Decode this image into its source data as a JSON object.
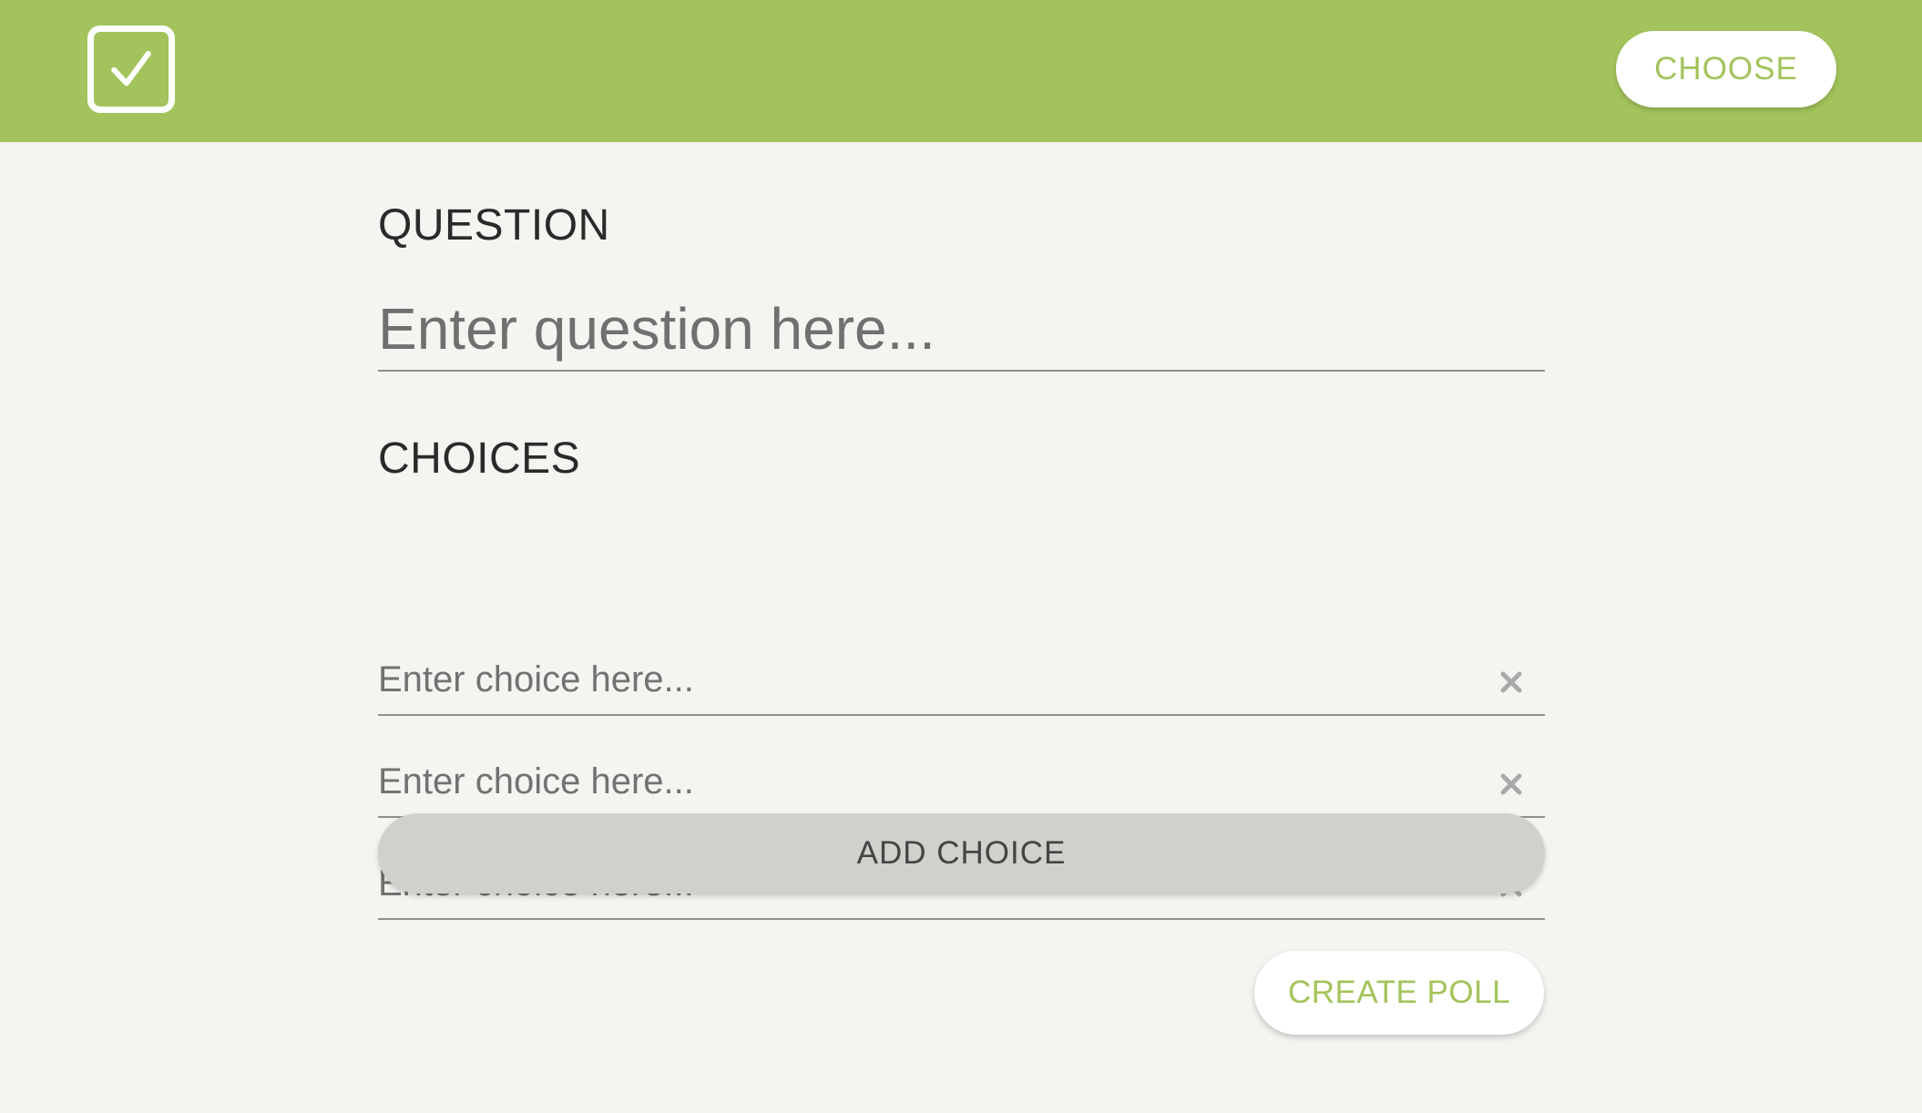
{
  "header": {
    "logo_icon": "checkbox-checked-icon",
    "choose_label": "CHOOSE",
    "background_color": "#a3c45c"
  },
  "form": {
    "question_label": "QUESTION",
    "question_placeholder": "Enter question here...",
    "question_value": "",
    "choices_label": "CHOICES",
    "choices": [
      {
        "placeholder": "Enter choice here...",
        "value": "",
        "remove_icon": "close-icon"
      },
      {
        "placeholder": "Enter choice here...",
        "value": "",
        "remove_icon": "close-icon"
      },
      {
        "placeholder": "Enter choice here...",
        "value": "",
        "remove_icon": "close-icon"
      }
    ],
    "add_choice_label": "ADD CHOICE",
    "create_poll_label": "CREATE POLL"
  },
  "colors": {
    "accent": "#a3c45c",
    "page_background": "#f5f4f1",
    "secondary_button": "#d0d0cc"
  }
}
